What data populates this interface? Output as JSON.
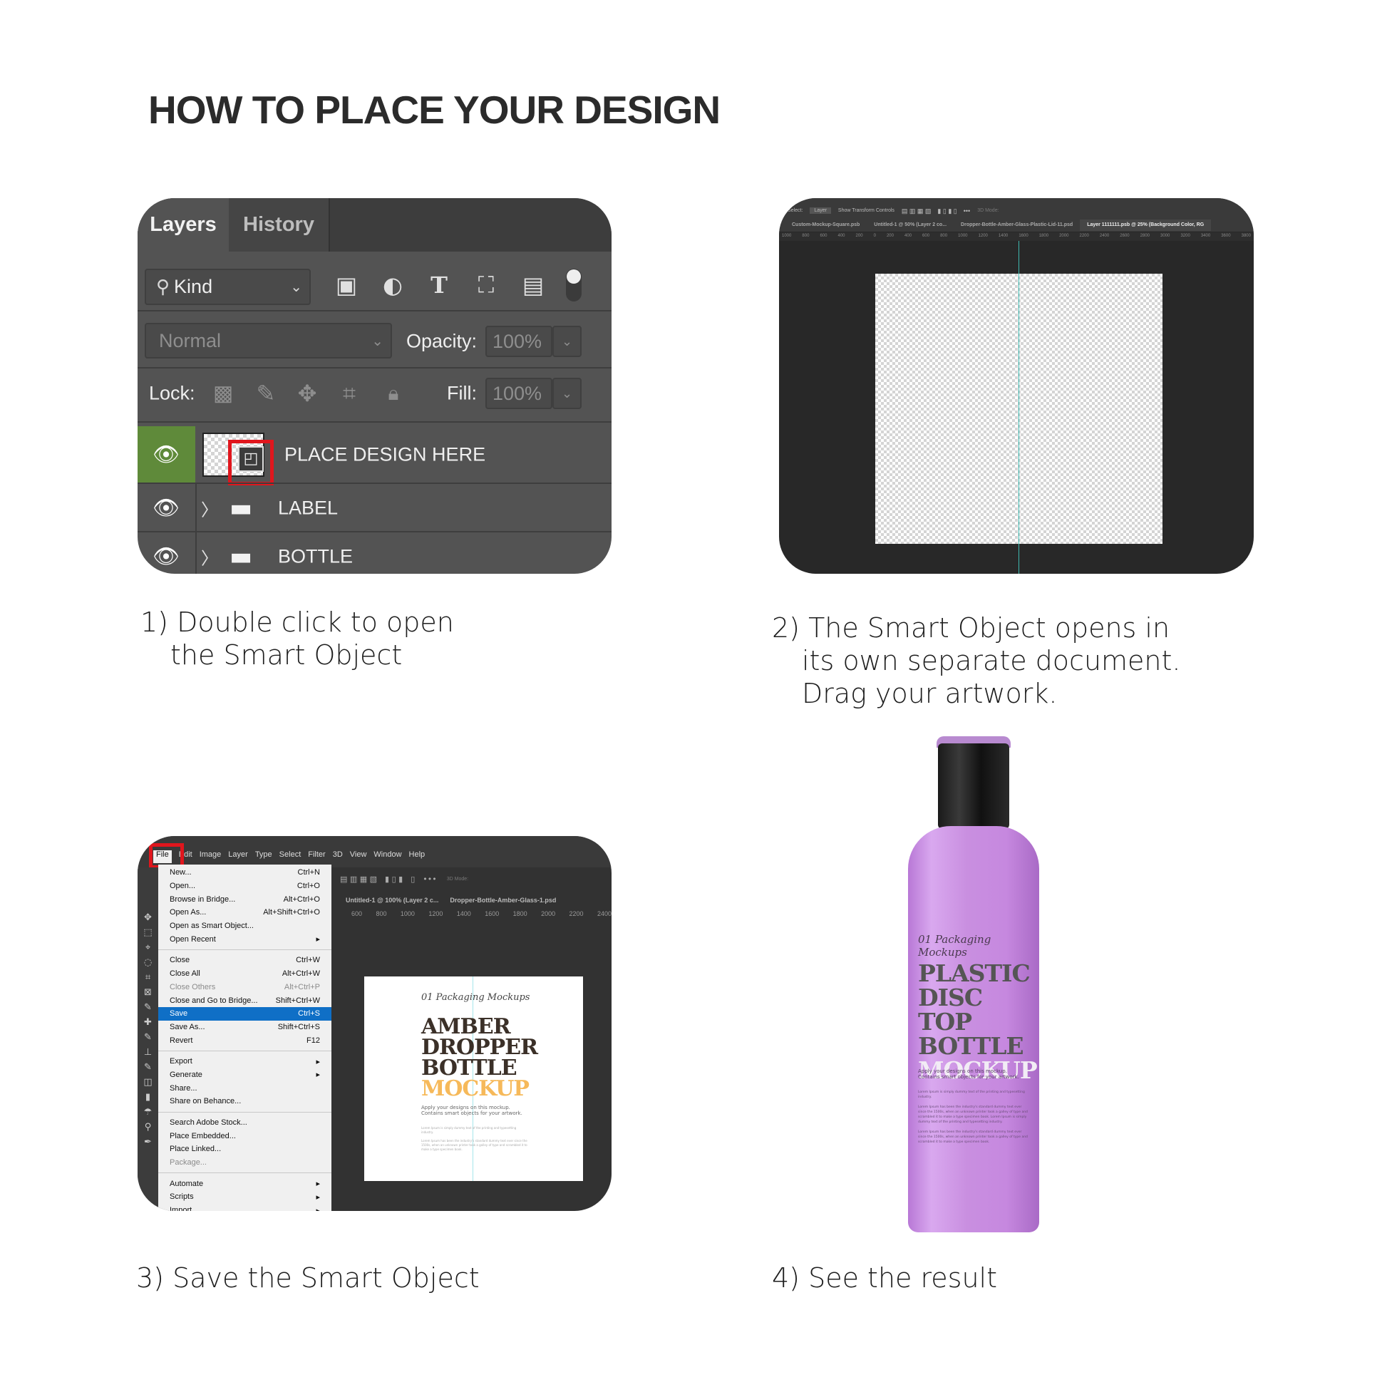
{
  "title": "HOW TO PLACE YOUR DESIGN",
  "steps": {
    "s1": {
      "line1": "1) Double click to open",
      "line2": "the Smart Object"
    },
    "s2": {
      "line1": "2) The Smart Object opens in",
      "line2": "its own separate document.",
      "line3": "Drag your artwork."
    },
    "s3": {
      "line1": "3) Save the Smart Object"
    },
    "s4": {
      "line1": "4) See the result"
    }
  },
  "layers_panel": {
    "tabs": [
      "Layers",
      "History"
    ],
    "active_tab": "Layers",
    "filter_kind": "Kind",
    "blend_mode": "Normal",
    "opacity_label": "Opacity:",
    "opacity": "100%",
    "lock_label": "Lock:",
    "fill_label": "Fill:",
    "fill": "100%",
    "filter_icons": [
      "image-icon",
      "adjustment-icon",
      "type-icon",
      "transform-icon",
      "smart-object-icon",
      "toggle-icon"
    ],
    "lock_icons": [
      "lock-transparent-icon",
      "lock-paint-icon",
      "lock-move-icon",
      "lock-artboard-icon",
      "lock-all-icon"
    ],
    "layers": [
      {
        "name": "PLACE DESIGN HERE",
        "type": "smart-object",
        "visible": true,
        "selected_highlight": true
      },
      {
        "name": "LABEL",
        "type": "group",
        "visible": true
      },
      {
        "name": "BOTTLE",
        "type": "group",
        "visible": true
      }
    ],
    "accent": "#5f8a3a",
    "highlight_box_color": "#e0161d"
  },
  "smart_object_doc": {
    "options": {
      "auto_select": "Select:",
      "target": "Layer",
      "show_transform": "Show Transform Controls",
      "mode_3d": "3D Mode:"
    },
    "tabs": [
      "Custom-Mockup-Square.psb",
      "Untitled-1 @ 50% (Layer 2 co...",
      "Dropper-Bottle-Amber-Glass-Plastic-Lid-11.psd",
      "Layer 1111111.psb @ 25% (Background Color, RG"
    ],
    "active_tab": "Layer 1111111.psb @ 25% (Background Color, RG",
    "ruler": [
      "1000",
      "800",
      "600",
      "400",
      "200",
      "0",
      "200",
      "400",
      "600",
      "800",
      "1000",
      "1200",
      "1400",
      "1600",
      "1800",
      "2000",
      "2200",
      "2400",
      "2600",
      "2800",
      "3000",
      "3200",
      "3400",
      "3600",
      "3800"
    ]
  },
  "file_menu_doc": {
    "menubar": [
      "File",
      "Edit",
      "Image",
      "Layer",
      "Type",
      "Select",
      "Filter",
      "3D",
      "View",
      "Window",
      "Help"
    ],
    "open_menu": "File",
    "tabs": [
      "Untitled-1 @ 100% (Layer 2 c...",
      "Dropper-Bottle-Amber-Glass-1.psd"
    ],
    "mode_3d": "3D Mode:",
    "ruler": [
      "600",
      "800",
      "1000",
      "1200",
      "1400",
      "1600",
      "1800",
      "2000",
      "2200",
      "2400"
    ],
    "menu_groups": [
      [
        {
          "label": "New...",
          "shortcut": "Ctrl+N"
        },
        {
          "label": "Open...",
          "shortcut": "Ctrl+O"
        },
        {
          "label": "Browse in Bridge...",
          "shortcut": "Alt+Ctrl+O"
        },
        {
          "label": "Open As...",
          "shortcut": "Alt+Shift+Ctrl+O"
        },
        {
          "label": "Open as Smart Object...",
          "shortcut": ""
        },
        {
          "label": "Open Recent",
          "shortcut": "▸"
        }
      ],
      [
        {
          "label": "Close",
          "shortcut": "Ctrl+W"
        },
        {
          "label": "Close All",
          "shortcut": "Alt+Ctrl+W"
        },
        {
          "label": "Close Others",
          "shortcut": "Alt+Ctrl+P",
          "disabled": true
        },
        {
          "label": "Close and Go to Bridge...",
          "shortcut": "Shift+Ctrl+W"
        },
        {
          "label": "Save",
          "shortcut": "Ctrl+S",
          "highlighted": true
        },
        {
          "label": "Save As...",
          "shortcut": "Shift+Ctrl+S"
        },
        {
          "label": "Revert",
          "shortcut": "F12"
        }
      ],
      [
        {
          "label": "Export",
          "shortcut": "▸"
        },
        {
          "label": "Generate",
          "shortcut": "▸"
        },
        {
          "label": "Share...",
          "shortcut": ""
        },
        {
          "label": "Share on Behance...",
          "shortcut": ""
        }
      ],
      [
        {
          "label": "Search Adobe Stock...",
          "shortcut": ""
        },
        {
          "label": "Place Embedded...",
          "shortcut": ""
        },
        {
          "label": "Place Linked...",
          "shortcut": ""
        },
        {
          "label": "Package...",
          "shortcut": "",
          "disabled": true
        }
      ],
      [
        {
          "label": "Automate",
          "shortcut": "▸"
        },
        {
          "label": "Scripts",
          "shortcut": "▸"
        },
        {
          "label": "Import",
          "shortcut": "▸"
        }
      ]
    ],
    "highlight_color": "#0f6fc6",
    "artwork": {
      "script": "01 Packaging Mockups",
      "lines": [
        "AMBER",
        "DROPPER",
        "BOTTLE"
      ],
      "accent_line": "MOCKUP",
      "accent_color": "#f6b95a",
      "tagline1": "Apply your designs on this mockup.",
      "tagline2": "Contains smart objects for your artwork.",
      "body1": "Lorem Ipsum is simply dummy text of the printing and typesetting industry.",
      "body2": "Lorem Ipsum has been the industry's standard dummy text ever since the 1500s, when an unknown printer took a galley of type and scrambled it to make a type specimen book."
    }
  },
  "result_bottle": {
    "color": "#c98fe0",
    "script": "01 Packaging Mockups",
    "lines": [
      "PLASTIC",
      "DISC TOP",
      "BOTTLE"
    ],
    "accent_line": "MOCKUP",
    "tagline1": "Apply your designs on this mockup.",
    "tagline2": "Contains smart objects for your artwork.",
    "body1": "Lorem Ipsum is simply dummy text of the printing and typesetting industry.",
    "body2": "Lorem Ipsum has been the industry's standard dummy text ever since the 1500s, when an unknown printer took a galley of type and scrambled it to make a type specimen book. Lorem Ipsum is simply dummy text of the printing and typesetting industry.",
    "body3": "Lorem Ipsum has been the industry's standard dummy text ever since the 1500s, when an unknown printer took a galley of type and scrambled it to make a type specimen book."
  }
}
